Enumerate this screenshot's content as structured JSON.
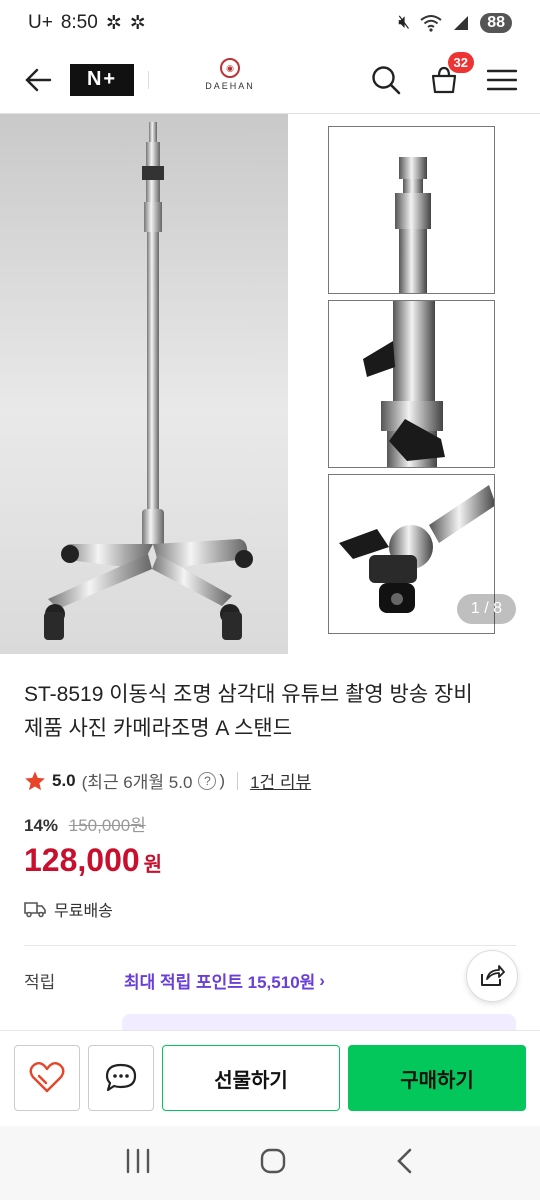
{
  "status": {
    "carrier": "U+",
    "time": "8:50",
    "battery": "88"
  },
  "nav": {
    "store_badge": "N+",
    "brand": "DAEHAN",
    "cart_count": "32"
  },
  "gallery": {
    "counter": "1 / 8"
  },
  "product": {
    "title_line1": "ST-8519 이동식 조명 삼각대 유튜브 촬영 방송 장비",
    "title_line2": "제품 사진 카메라조명 A 스탠드",
    "rating_score": "5.0",
    "rating_recent": "(최근 6개월 5.0",
    "rating_recent_close": ")",
    "review_count": "1건 리뷰",
    "discount": "14%",
    "original_price": "150,000원",
    "price": "128,000",
    "price_unit": "원",
    "shipping": "무료배송",
    "points_label": "적립",
    "points_value": "최대 적립 포인트 15,510원"
  },
  "actions": {
    "gift_label": "선물하기",
    "buy_label": "구매하기"
  },
  "colors": {
    "accent_green": "#03c75a",
    "price_red": "#c8102e",
    "points_purple": "#6a3fd8",
    "badge_red": "#e33"
  }
}
